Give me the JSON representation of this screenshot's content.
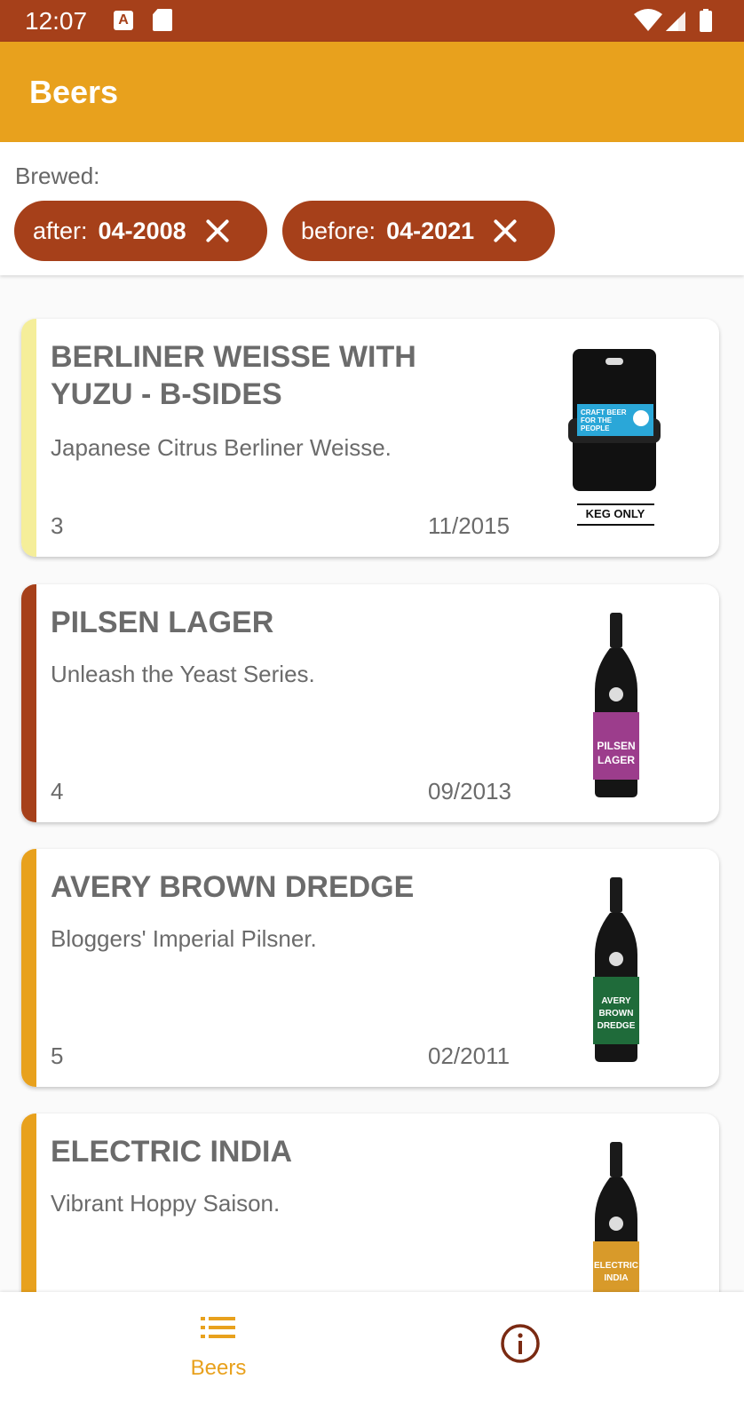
{
  "status": {
    "time": "12:07",
    "icon_a": "A"
  },
  "app": {
    "title": "Beers"
  },
  "filters": {
    "label": "Brewed:",
    "after": {
      "label": "after:",
      "value": "04-2008"
    },
    "before": {
      "label": "before:",
      "value": "04-2021"
    }
  },
  "beers": [
    {
      "name": "Berliner Weisse With Yuzu - B-Sides",
      "tagline": "Japanese Citrus Berliner Weisse.",
      "count": "3",
      "date": "11/2015",
      "accent": "#f5ee9a",
      "keg_text": "KEG ONLY",
      "keg_label": "CRAFT BEER FOR THE PEOPLE"
    },
    {
      "name": "Pilsen Lager",
      "tagline": "Unleash the Yeast Series.",
      "count": "4",
      "date": "09/2013",
      "accent": "#a6401a",
      "label_text": "PILSEN LAGER"
    },
    {
      "name": "Avery Brown Dredge",
      "tagline": "Bloggers' Imperial Pilsner.",
      "count": "5",
      "date": "02/2011",
      "accent": "#e8a11d",
      "label_text": "AVERY BROWN DREDGE"
    },
    {
      "name": "Electric India",
      "tagline": "Vibrant Hoppy Saison.",
      "count": "",
      "date": "",
      "accent": "#e8a11d",
      "label_text": "ELECTRIC INDIA"
    }
  ],
  "nav": {
    "beers_label": "Beers"
  },
  "colors": {
    "primary": "#e8a11d",
    "status_bar": "#a6401a",
    "chip": "#a6401a"
  }
}
